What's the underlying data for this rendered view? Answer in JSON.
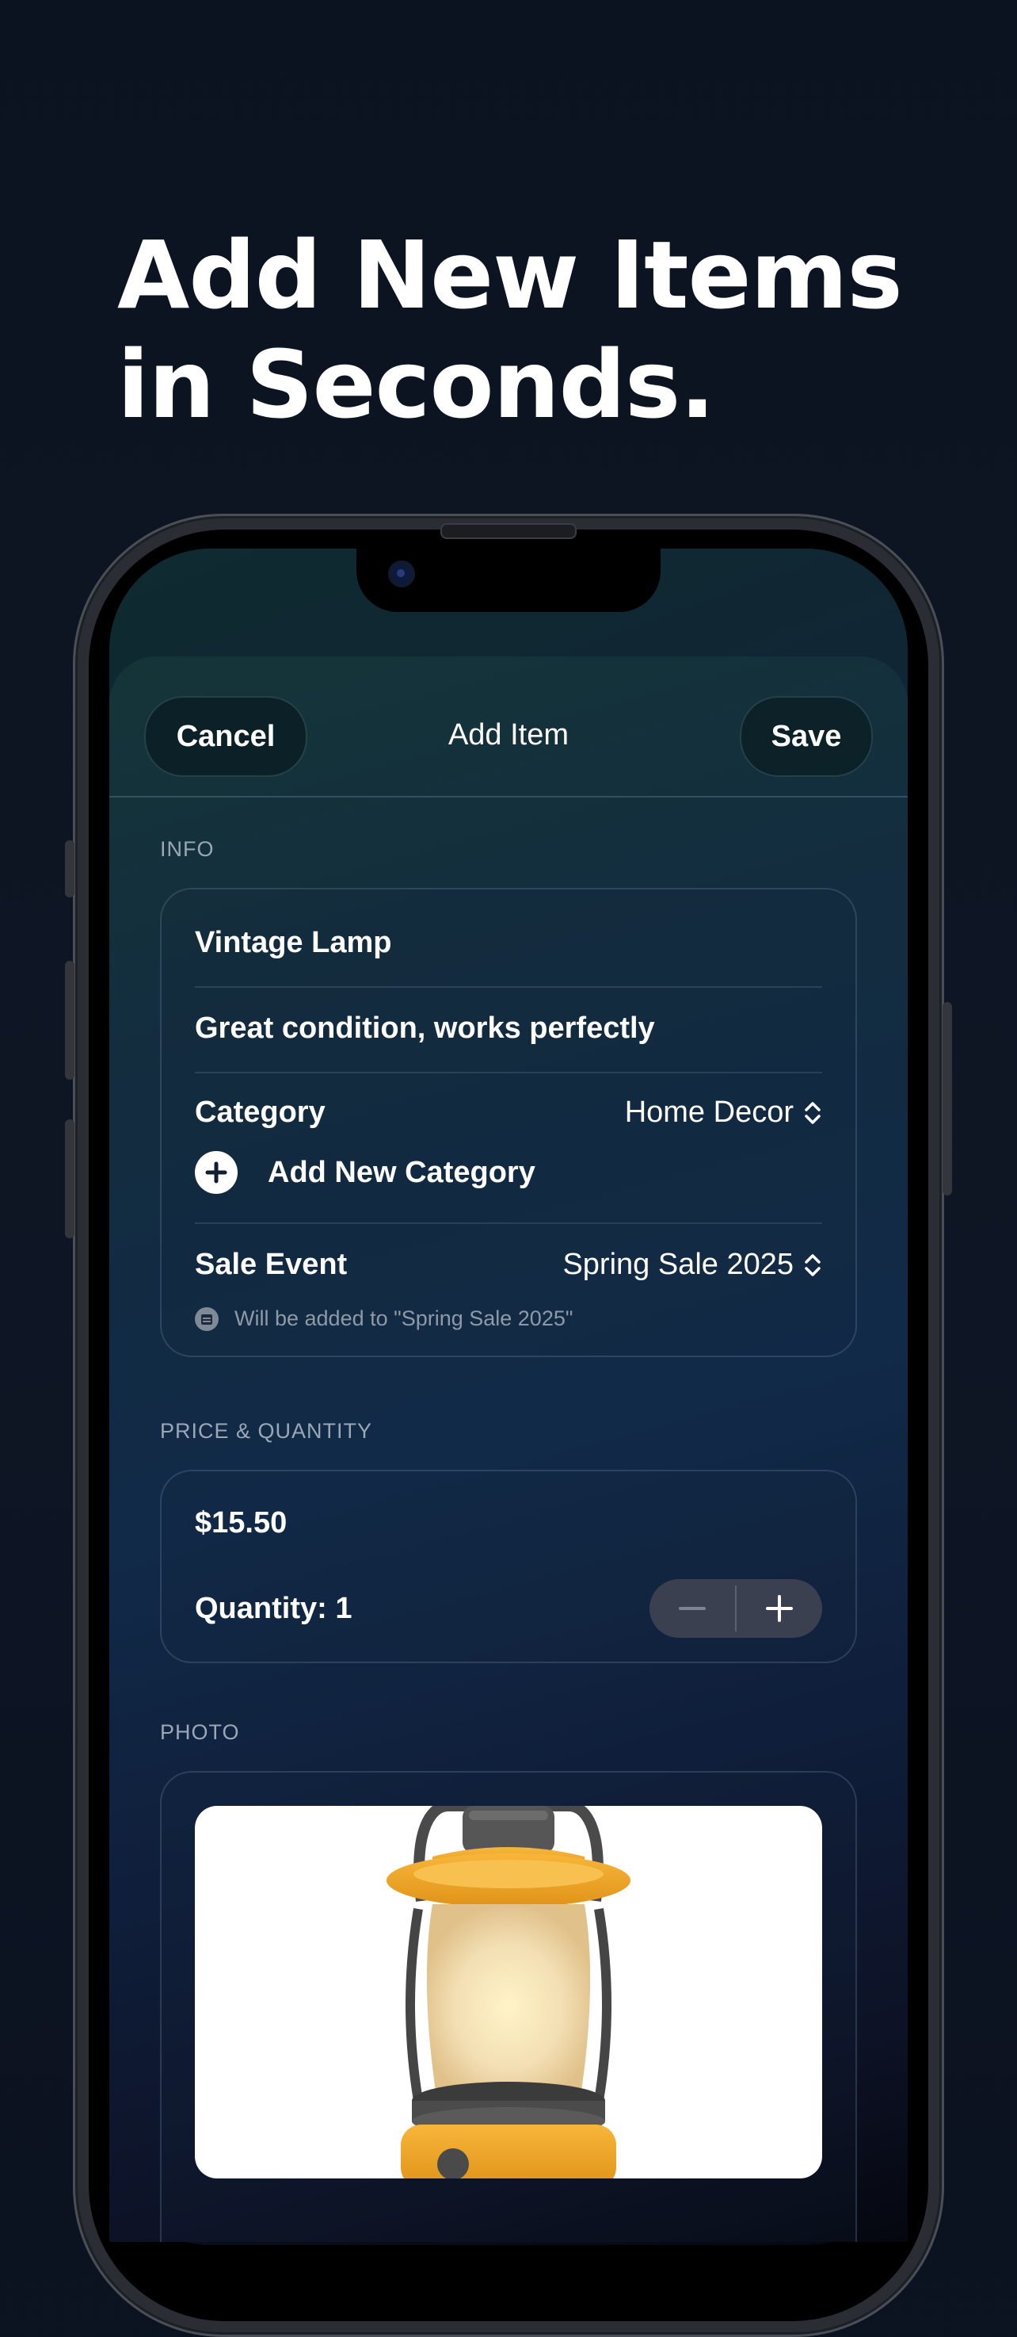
{
  "headline": {
    "line1": "Add New Items",
    "line2": "in Seconds."
  },
  "sheet": {
    "cancel_label": "Cancel",
    "title": "Add Item",
    "save_label": "Save"
  },
  "info": {
    "section_label": "INFO",
    "name_value": "Vintage Lamp",
    "description_value": "Great condition, works perfectly",
    "category_label": "Category",
    "category_value": "Home Decor",
    "add_category_label": "Add New Category",
    "sale_event_label": "Sale Event",
    "sale_event_value": "Spring Sale 2025",
    "sale_event_note": "Will be added to \"Spring Sale 2025\""
  },
  "price": {
    "section_label": "PRICE & QUANTITY",
    "price_value": "$15.50",
    "quantity_label": "Quantity: 1"
  },
  "photo": {
    "section_label": "PHOTO"
  },
  "icons": {
    "plus": "plus-circle-icon",
    "chevron": "chevron-up-down-icon",
    "calendar": "calendar-icon",
    "minus": "minus-icon",
    "stepper_plus": "plus-icon"
  },
  "colors": {
    "accent_orange": "#f0a323",
    "background": "#0c1320"
  }
}
